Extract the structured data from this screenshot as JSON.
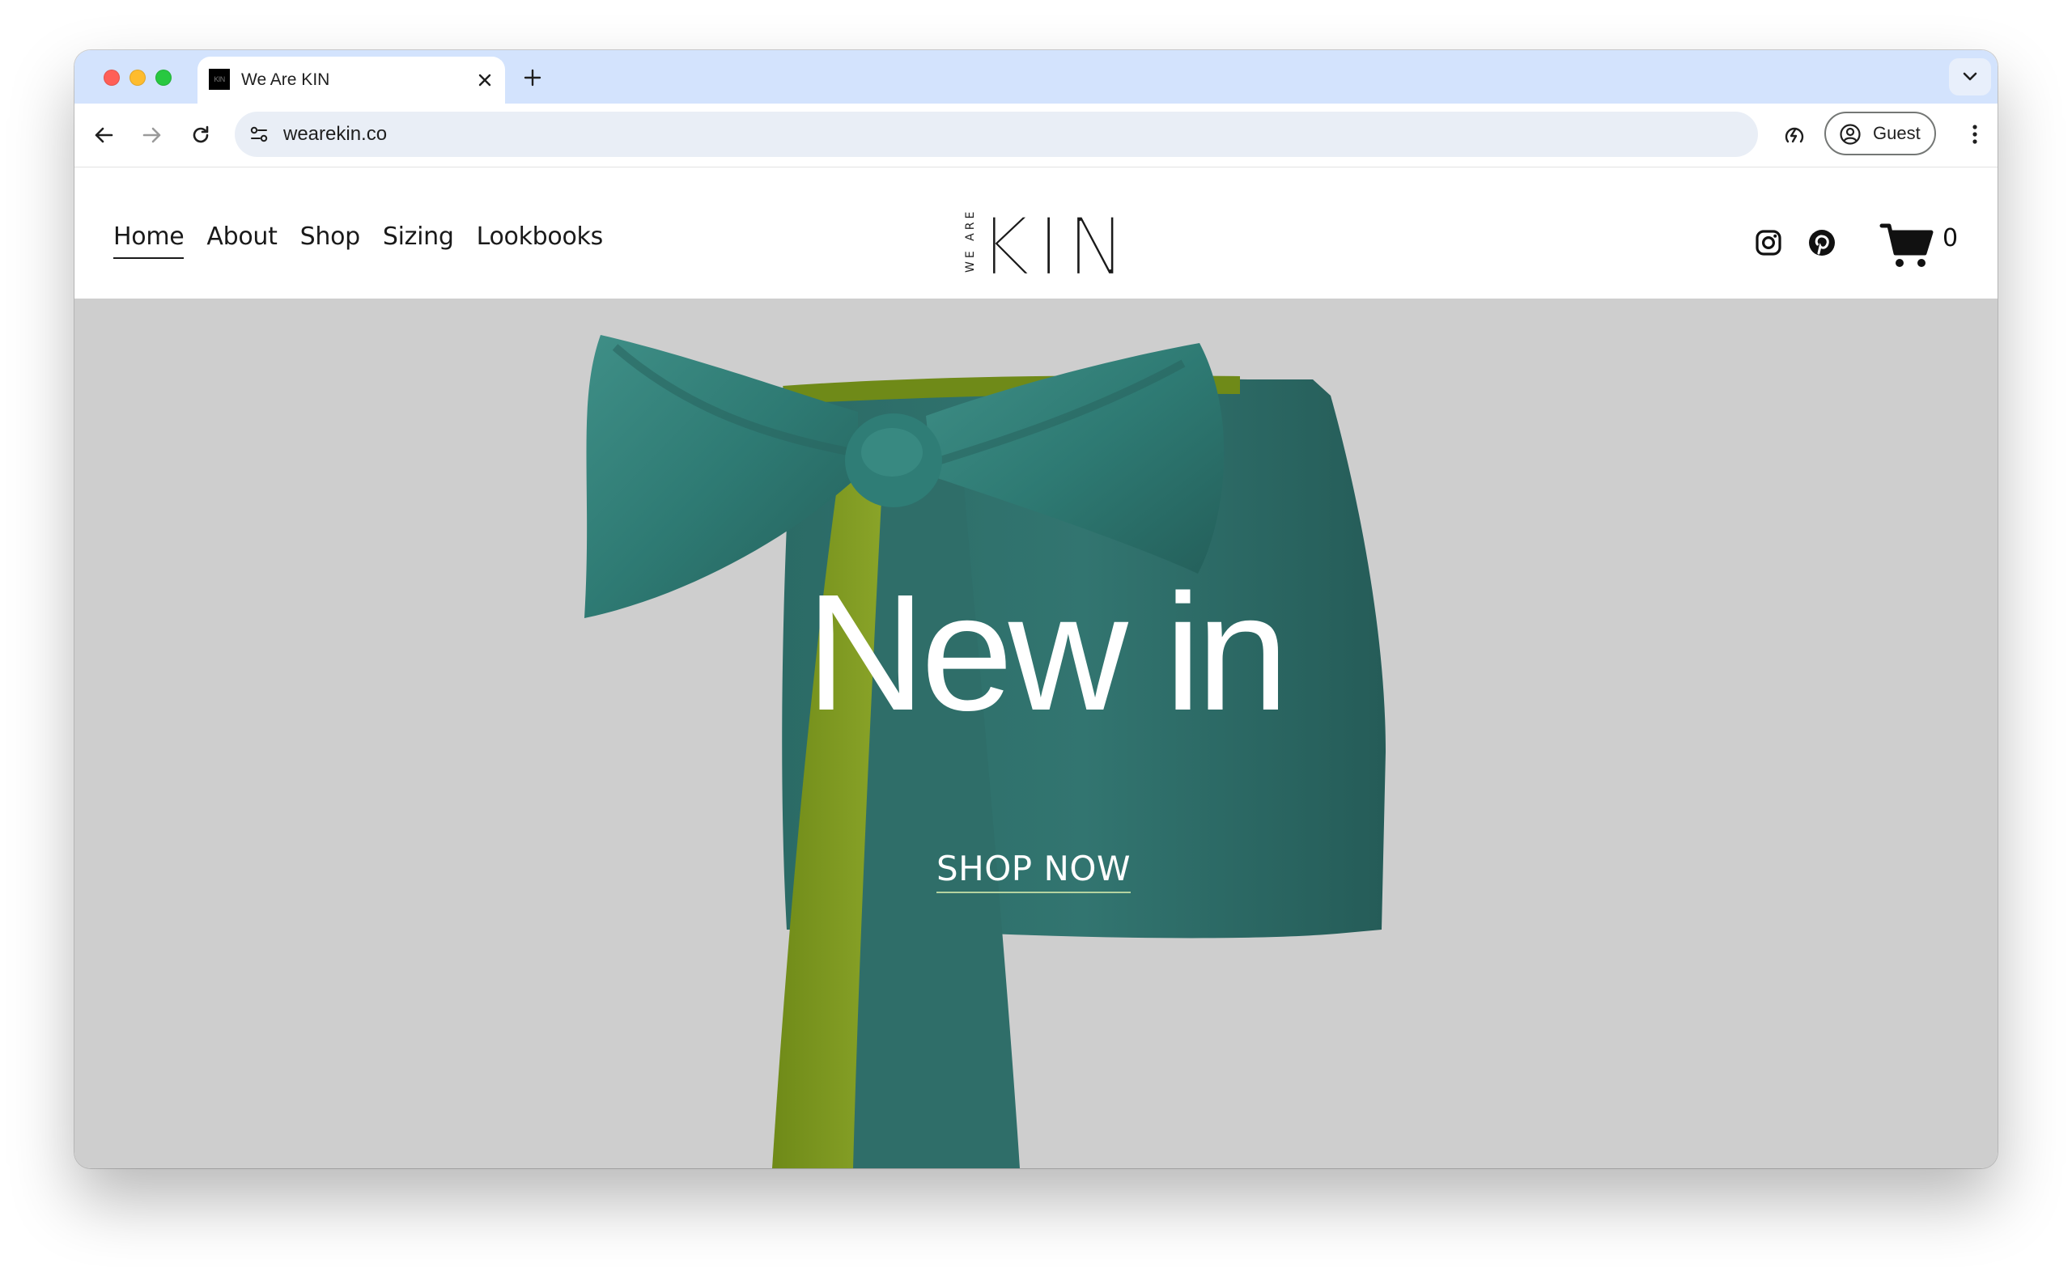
{
  "browser": {
    "tab": {
      "favicon_text": "KIN",
      "title": "We Are KIN"
    },
    "address": {
      "url": "wearekin.co"
    },
    "profile": {
      "label": "Guest"
    }
  },
  "site": {
    "nav": [
      {
        "label": "Home",
        "active": true
      },
      {
        "label": "About",
        "active": false
      },
      {
        "label": "Shop",
        "active": false
      },
      {
        "label": "Sizing",
        "active": false
      },
      {
        "label": "Lookbooks",
        "active": false
      }
    ],
    "logo": {
      "small_text": "WE ARE",
      "text": "KIN"
    },
    "cart": {
      "count": "0"
    },
    "hero": {
      "title": "New in",
      "cta": "SHOP NOW"
    }
  },
  "colors": {
    "tabbar": "#d3e3fd",
    "hero_bg": "#cecece",
    "fabric_teal": "#2f6d68",
    "fabric_lining": "#7e9a1f",
    "cta_underline": "#b4d3a0"
  },
  "icons": [
    "back-arrow-icon",
    "forward-arrow-icon",
    "reload-icon",
    "site-info-icon",
    "performance-icon",
    "profile-icon",
    "more-vert-icon",
    "instagram-icon",
    "pinterest-icon",
    "cart-icon"
  ]
}
